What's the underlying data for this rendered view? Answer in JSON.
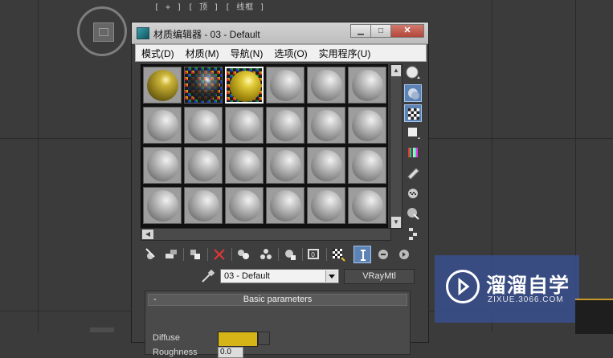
{
  "viewport": {
    "top_label": "[ + ] [ 顶 ] [ 线框 ]"
  },
  "window": {
    "title": "材质编辑器 - 03 - Default",
    "buttons": {
      "minimize": "▁",
      "maximize": "□",
      "close": "✕"
    }
  },
  "menu": {
    "items": [
      "模式(D)",
      "材质(M)",
      "导航(N)",
      "选项(O)",
      "实用程序(U)"
    ]
  },
  "slots": {
    "rows": 4,
    "columns": 6,
    "special": [
      {
        "index": 0,
        "kind": "olive"
      },
      {
        "index": 1,
        "kind": "glass-checker"
      },
      {
        "index": 2,
        "kind": "gold-checker",
        "selected": true
      }
    ]
  },
  "side_tools": [
    {
      "name": "sample-type-icon",
      "active": false
    },
    {
      "name": "backlight-icon",
      "active": true
    },
    {
      "name": "background-checker-icon",
      "active": true
    },
    {
      "name": "sample-uv-tiling-icon",
      "active": false
    },
    {
      "name": "video-color-check-icon",
      "active": false
    },
    {
      "name": "make-preview-icon",
      "active": false
    },
    {
      "name": "options-icon",
      "active": false
    },
    {
      "name": "select-by-material-icon",
      "active": false
    },
    {
      "name": "material-map-navigator-icon",
      "active": false
    }
  ],
  "bottom_tools": [
    {
      "name": "get-material-icon",
      "active": false
    },
    {
      "name": "put-material-to-scene-icon",
      "active": false
    },
    {
      "name": "assign-material-icon",
      "active": false
    },
    {
      "name": "delete-icon",
      "active": false
    },
    {
      "name": "copy-material-icon",
      "active": false
    },
    {
      "name": "make-unique-icon",
      "active": false
    },
    {
      "name": "put-to-library-icon",
      "active": false
    },
    {
      "name": "material-id-channel-icon",
      "active": false
    },
    {
      "name": "show-shaded-material-icon",
      "active": false
    },
    {
      "name": "show-end-result-icon",
      "active": true
    },
    {
      "name": "go-to-parent-icon",
      "active": false
    },
    {
      "name": "go-forward-sibling-icon",
      "active": false
    }
  ],
  "material": {
    "name": "03 - Default",
    "type": "VRayMtl"
  },
  "rollout": {
    "title": "Basic parameters",
    "collapse": "-",
    "params": {
      "diffuse_label": "Diffuse",
      "diffuse_color": "#d4b417",
      "roughness_label": "Roughness",
      "roughness_value": "0.0"
    }
  },
  "watermark": {
    "title": "溜溜自学",
    "subtitle": "ZIXUE.3066.COM"
  }
}
